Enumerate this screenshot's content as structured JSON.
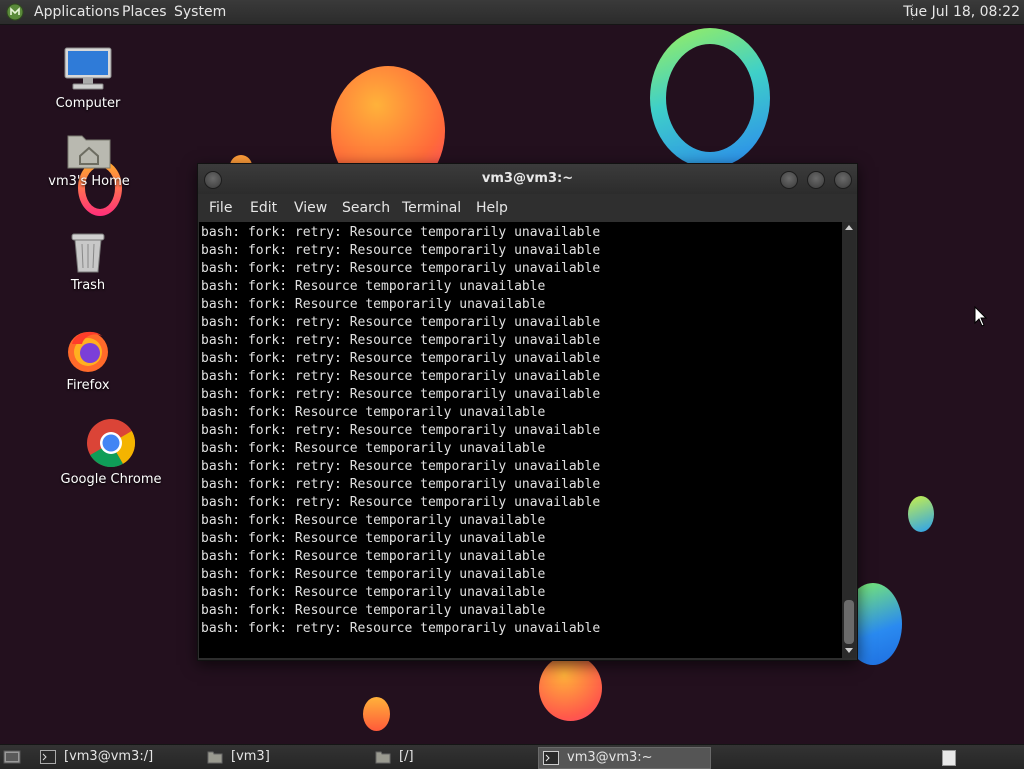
{
  "top_panel": {
    "menus": {
      "applications": "Applications",
      "places": "Places",
      "system": "System"
    },
    "clock": "Tue Jul 18, 08:22"
  },
  "desktop_icons": [
    {
      "label": "Computer",
      "icon": "computer-icon"
    },
    {
      "label": "vm3's Home",
      "icon": "home-folder-icon"
    },
    {
      "label": "Trash",
      "icon": "trash-icon"
    },
    {
      "label": "Firefox",
      "icon": "firefox-icon"
    },
    {
      "label": "Google Chrome",
      "icon": "chrome-icon"
    }
  ],
  "terminal_window": {
    "title": "vm3@vm3:~",
    "menu": {
      "file": "File",
      "edit": "Edit",
      "view": "View",
      "search": "Search",
      "terminal": "Terminal",
      "help": "Help"
    },
    "lines": [
      "bash: fork: retry: Resource temporarily unavailable",
      "bash: fork: retry: Resource temporarily unavailable",
      "bash: fork: retry: Resource temporarily unavailable",
      "bash: fork: Resource temporarily unavailable",
      "bash: fork: Resource temporarily unavailable",
      "bash: fork: retry: Resource temporarily unavailable",
      "bash: fork: retry: Resource temporarily unavailable",
      "bash: fork: retry: Resource temporarily unavailable",
      "bash: fork: retry: Resource temporarily unavailable",
      "bash: fork: retry: Resource temporarily unavailable",
      "bash: fork: Resource temporarily unavailable",
      "bash: fork: retry: Resource temporarily unavailable",
      "bash: fork: Resource temporarily unavailable",
      "bash: fork: retry: Resource temporarily unavailable",
      "bash: fork: retry: Resource temporarily unavailable",
      "bash: fork: retry: Resource temporarily unavailable",
      "bash: fork: Resource temporarily unavailable",
      "bash: fork: Resource temporarily unavailable",
      "bash: fork: Resource temporarily unavailable",
      "bash: fork: Resource temporarily unavailable",
      "bash: fork: Resource temporarily unavailable",
      "bash: fork: Resource temporarily unavailable",
      "bash: fork: retry: Resource temporarily unavailable"
    ]
  },
  "taskbar": {
    "tasks": [
      {
        "label": "[vm3@vm3:/]",
        "icon": "terminal-icon"
      },
      {
        "label": "[vm3]",
        "icon": "home-folder-icon"
      },
      {
        "label": "[/]",
        "icon": "folder-icon"
      },
      {
        "label": "vm3@vm3:~",
        "icon": "terminal-icon",
        "active": true
      }
    ]
  },
  "colors": {
    "desktop_bg": "#23101e",
    "panel_bg": "#2b2b2b",
    "terminal_bg": "#000000",
    "terminal_fg": "#e0e0e0"
  }
}
